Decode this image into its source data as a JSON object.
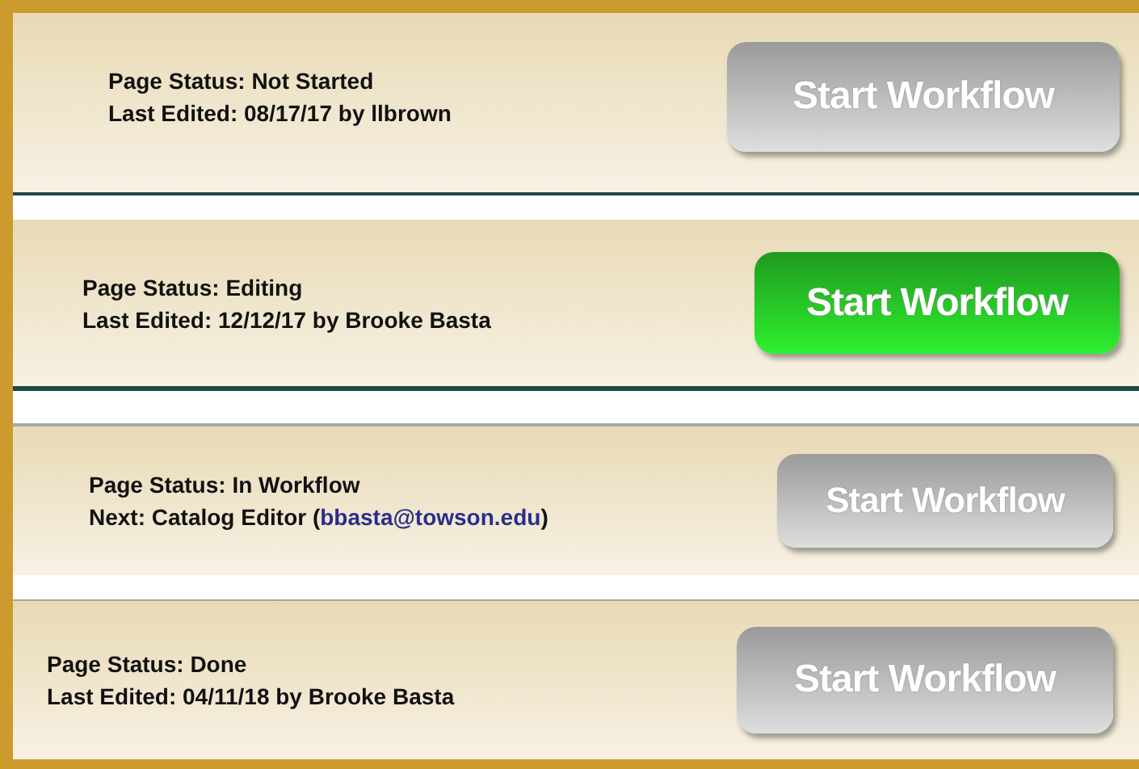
{
  "panels": [
    {
      "status": "Page Status: Not Started",
      "detail": {
        "text": "Last Edited: 08/17/17 by llbrown"
      },
      "button": {
        "label": "Start Workflow",
        "enabled": false
      }
    },
    {
      "status": "Page Status: Editing",
      "detail": {
        "text": "Last Edited: 12/12/17 by Brooke Basta"
      },
      "button": {
        "label": "Start Workflow",
        "enabled": true
      }
    },
    {
      "status": "Page Status: In Workflow",
      "detail": {
        "text": "Next: Catalog Editor (",
        "link": "bbasta@towson.edu",
        "after": ")"
      },
      "button": {
        "label": "Start Workflow",
        "enabled": false
      }
    },
    {
      "status": "Page Status: Done",
      "detail": {
        "text": "Last Edited: 04/11/18 by Brooke Basta"
      },
      "button": {
        "label": "Start Workflow",
        "enabled": false
      }
    }
  ]
}
